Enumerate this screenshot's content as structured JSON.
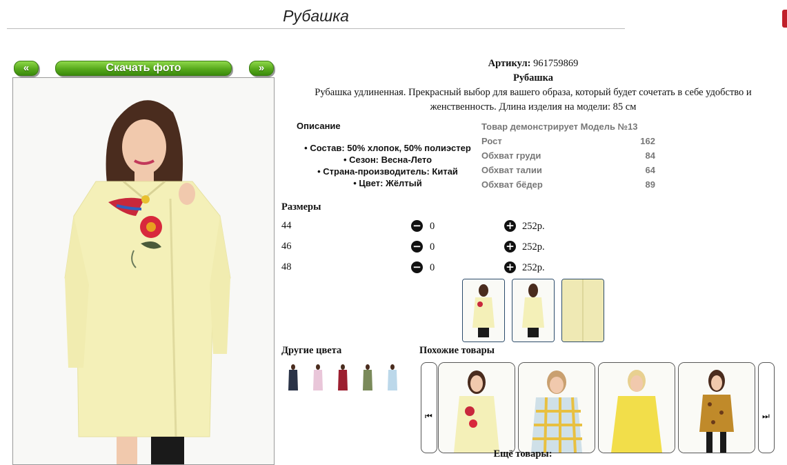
{
  "page": {
    "title": "Рубашка"
  },
  "nav": {
    "prev_label": "«",
    "next_label": "»",
    "download_label": "Скачать фото"
  },
  "product": {
    "article_label": "Артикул:",
    "article_value": "961759869",
    "name": "Рубашка",
    "description": "Рубашка удлиненная. Прекрасный выбор для вашего образа, который будет сочетать в себе удобство и женственность. Длина изделия на модели: 85 см"
  },
  "details": {
    "heading": "Описание",
    "items": [
      "Состав: 50% хлопок, 50% полиэстер",
      "Сезон: Весна-Лето",
      "Страна-производитель: Китай",
      "Цвет: Жёлтый"
    ]
  },
  "model": {
    "heading": "Товар демонстрирует Модель №13",
    "rows": [
      {
        "label": "Рост",
        "value": "162"
      },
      {
        "label": "Обхват груди",
        "value": "84"
      },
      {
        "label": "Обхват талии",
        "value": "64"
      },
      {
        "label": "Обхват бёдер",
        "value": "89"
      }
    ]
  },
  "sizes": {
    "heading": "Размеры",
    "rows": [
      {
        "size": "44",
        "qty": "0",
        "price": "252р."
      },
      {
        "size": "46",
        "qty": "0",
        "price": "252р."
      },
      {
        "size": "48",
        "qty": "0",
        "price": "252р."
      }
    ]
  },
  "other_colors": {
    "heading": "Другие цвета",
    "swatch_colors": [
      "#2a3347",
      "#e9c6d9",
      "#9c1f30",
      "#7a8a5a",
      "#bcd8ea"
    ]
  },
  "similar": {
    "heading": "Похожие товары",
    "prev_icon": "⏮",
    "next_icon": "⏭"
  },
  "more_label": "Ещё товары:",
  "colors": {
    "accent_green": "#57a91c",
    "shirt_yellow": "#f4f0b8"
  }
}
